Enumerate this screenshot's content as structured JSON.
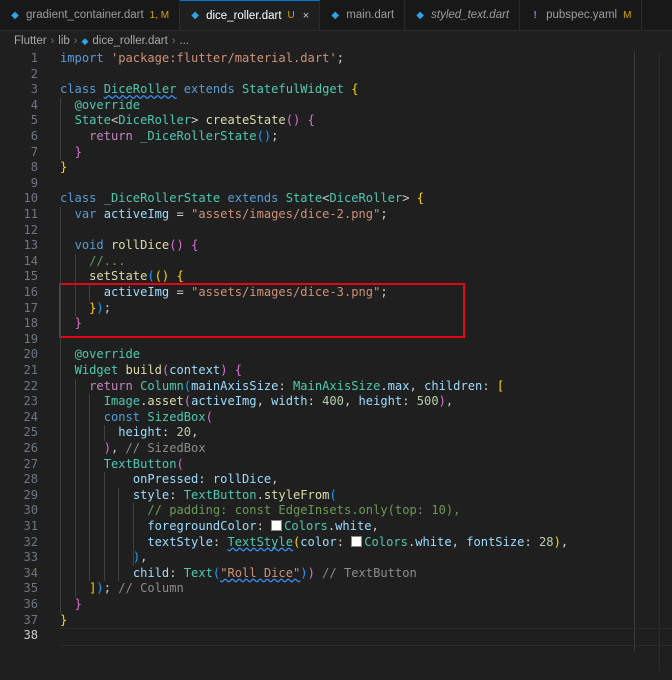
{
  "tabs": [
    {
      "label": "gradient_container.dart",
      "badge": "1, M",
      "icon": "dart-icon",
      "active": false
    },
    {
      "label": "dice_roller.dart",
      "badge": "U",
      "icon": "dart-icon",
      "active": true,
      "close": "×"
    },
    {
      "label": "main.dart",
      "icon": "dart-icon",
      "active": false
    },
    {
      "label": "styled_text.dart",
      "icon": "dart-icon",
      "active": false,
      "italic": true
    },
    {
      "label": "pubspec.yaml",
      "badge": "M",
      "icon": "warning-exclamation-icon",
      "active": false
    }
  ],
  "breadcrumb": {
    "items": [
      "Flutter",
      "lib",
      "dice_roller.dart",
      "..."
    ],
    "separator": "›"
  },
  "editor": {
    "line_numbers": [
      "1",
      "2",
      "3",
      "4",
      "5",
      "6",
      "7",
      "8",
      "9",
      "10",
      "11",
      "12",
      "13",
      "14",
      "15",
      "16",
      "17",
      "18",
      "19",
      "20",
      "21",
      "22",
      "23",
      "24",
      "25",
      "26",
      "27",
      "28",
      "29",
      "30",
      "31",
      "32",
      "33",
      "34",
      "35",
      "36",
      "37",
      "38"
    ],
    "current_line": "38",
    "lines": [
      [
        [
          "import",
          "kw"
        ],
        [
          " ",
          "txt"
        ],
        [
          "'package:flutter/material.dart'",
          "str"
        ],
        [
          ";",
          "txt"
        ]
      ],
      [],
      [
        [
          "class",
          "kw"
        ],
        [
          " ",
          "txt"
        ],
        [
          "DiceRoller",
          "cls sq"
        ],
        [
          " ",
          "txt"
        ],
        [
          "extends",
          "kw"
        ],
        [
          " ",
          "txt"
        ],
        [
          "StatefulWidget",
          "cls"
        ],
        [
          " ",
          "txt"
        ],
        [
          "{",
          "p1"
        ]
      ],
      [
        [
          "  ",
          "txt"
        ],
        [
          "@override",
          "ann"
        ]
      ],
      [
        [
          "  ",
          "txt"
        ],
        [
          "State",
          "cls"
        ],
        [
          "<",
          "txt"
        ],
        [
          "DiceRoller",
          "cls"
        ],
        [
          ">",
          "txt"
        ],
        [
          " ",
          "txt"
        ],
        [
          "createState",
          "fn"
        ],
        [
          "()",
          "p2"
        ],
        [
          " ",
          "txt"
        ],
        [
          "{",
          "p2"
        ]
      ],
      [
        [
          "    ",
          "txt"
        ],
        [
          "return",
          "ctl"
        ],
        [
          " ",
          "txt"
        ],
        [
          "_DiceRollerState",
          "cls"
        ],
        [
          "()",
          "p3"
        ],
        [
          ";",
          "txt"
        ]
      ],
      [
        [
          "  ",
          "txt"
        ],
        [
          "}",
          "p2"
        ]
      ],
      [
        [
          "}",
          "p1"
        ]
      ],
      [],
      [
        [
          "class",
          "kw"
        ],
        [
          " ",
          "txt"
        ],
        [
          "_DiceRollerState",
          "cls"
        ],
        [
          " ",
          "txt"
        ],
        [
          "extends",
          "kw"
        ],
        [
          " ",
          "txt"
        ],
        [
          "State",
          "cls"
        ],
        [
          "<",
          "txt"
        ],
        [
          "DiceRoller",
          "cls"
        ],
        [
          ">",
          "txt"
        ],
        [
          " ",
          "txt"
        ],
        [
          "{",
          "p1"
        ]
      ],
      [
        [
          "  ",
          "txt"
        ],
        [
          "var",
          "kw"
        ],
        [
          " ",
          "txt"
        ],
        [
          "activeImg",
          "var"
        ],
        [
          " = ",
          "txt"
        ],
        [
          "\"assets/images/dice-2.png\"",
          "str"
        ],
        [
          ";",
          "txt"
        ]
      ],
      [],
      [
        [
          "  ",
          "txt"
        ],
        [
          "void",
          "kw"
        ],
        [
          " ",
          "txt"
        ],
        [
          "rollDice",
          "fn"
        ],
        [
          "()",
          "p2"
        ],
        [
          " ",
          "txt"
        ],
        [
          "{",
          "p2"
        ]
      ],
      [
        [
          "    ",
          "txt"
        ],
        [
          "//...",
          "cm"
        ]
      ],
      [
        [
          "    ",
          "txt"
        ],
        [
          "setState",
          "fn"
        ],
        [
          "(",
          "p3"
        ],
        [
          "()",
          "p1"
        ],
        [
          " ",
          "txt"
        ],
        [
          "{",
          "p1"
        ]
      ],
      [
        [
          "      ",
          "txt"
        ],
        [
          "activeImg",
          "var"
        ],
        [
          " = ",
          "txt"
        ],
        [
          "\"assets/images/dice-3.png\"",
          "str"
        ],
        [
          ";",
          "txt"
        ]
      ],
      [
        [
          "    ",
          "txt"
        ],
        [
          "}",
          "p1"
        ],
        [
          ")",
          "p3"
        ],
        [
          ";",
          "txt"
        ]
      ],
      [
        [
          "  ",
          "txt"
        ],
        [
          "}",
          "p2"
        ]
      ],
      [],
      [
        [
          "  ",
          "txt"
        ],
        [
          "@override",
          "ann"
        ]
      ],
      [
        [
          "  ",
          "txt"
        ],
        [
          "Widget",
          "cls"
        ],
        [
          " ",
          "txt"
        ],
        [
          "build",
          "fn"
        ],
        [
          "(",
          "p2"
        ],
        [
          "context",
          "var"
        ],
        [
          ")",
          "p2"
        ],
        [
          " ",
          "txt"
        ],
        [
          "{",
          "p2"
        ]
      ],
      [
        [
          "    ",
          "txt"
        ],
        [
          "return",
          "ctl"
        ],
        [
          " ",
          "txt"
        ],
        [
          "Column",
          "cls"
        ],
        [
          "(",
          "p3"
        ],
        [
          "mainAxisSize",
          "var"
        ],
        [
          ": ",
          "txt"
        ],
        [
          "MainAxisSize",
          "cls"
        ],
        [
          ".",
          "txt"
        ],
        [
          "max",
          "var"
        ],
        [
          ", ",
          "txt"
        ],
        [
          "children",
          "var"
        ],
        [
          ": ",
          "txt"
        ],
        [
          "[",
          "p1"
        ]
      ],
      [
        [
          "      ",
          "txt"
        ],
        [
          "Image",
          "cls"
        ],
        [
          ".",
          "txt"
        ],
        [
          "asset",
          "fn"
        ],
        [
          "(",
          "p2"
        ],
        [
          "activeImg",
          "var"
        ],
        [
          ", ",
          "txt"
        ],
        [
          "width",
          "var"
        ],
        [
          ": ",
          "txt"
        ],
        [
          "400",
          "num"
        ],
        [
          ", ",
          "txt"
        ],
        [
          "height",
          "var"
        ],
        [
          ": ",
          "txt"
        ],
        [
          "500",
          "num"
        ],
        [
          ")",
          "p2"
        ],
        [
          ",",
          "txt"
        ]
      ],
      [
        [
          "      ",
          "txt"
        ],
        [
          "const",
          "kw"
        ],
        [
          " ",
          "txt"
        ],
        [
          "SizedBox",
          "cls"
        ],
        [
          "(",
          "p2"
        ]
      ],
      [
        [
          "        ",
          "txt"
        ],
        [
          "height",
          "var"
        ],
        [
          ": ",
          "txt"
        ],
        [
          "20",
          "num"
        ],
        [
          ",",
          "txt"
        ]
      ],
      [
        [
          "      ",
          "txt"
        ],
        [
          ")",
          "p2"
        ],
        [
          ", ",
          "txt"
        ],
        [
          "// SizedBox",
          "gray"
        ]
      ],
      [
        [
          "      ",
          "txt"
        ],
        [
          "TextButton",
          "cls"
        ],
        [
          "(",
          "p2"
        ]
      ],
      [
        [
          "          ",
          "txt"
        ],
        [
          "onPressed",
          "var"
        ],
        [
          ": ",
          "txt"
        ],
        [
          "rollDice",
          "var"
        ],
        [
          ",",
          "txt"
        ]
      ],
      [
        [
          "          ",
          "txt"
        ],
        [
          "style",
          "var"
        ],
        [
          ": ",
          "txt"
        ],
        [
          "TextButton",
          "cls"
        ],
        [
          ".",
          "txt"
        ],
        [
          "styleFrom",
          "fn"
        ],
        [
          "(",
          "p3"
        ]
      ],
      [
        [
          "            ",
          "txt"
        ],
        [
          "// padding: const EdgeInsets.only(top: 10),",
          "cm"
        ]
      ],
      [
        [
          "            ",
          "txt"
        ],
        [
          "foregroundColor",
          "var"
        ],
        [
          ": ",
          "txt"
        ],
        [
          "■",
          "swatch"
        ],
        [
          "Colors",
          "cls"
        ],
        [
          ".",
          "txt"
        ],
        [
          "white",
          "var"
        ],
        [
          ",",
          "txt"
        ]
      ],
      [
        [
          "            ",
          "txt"
        ],
        [
          "textStyle",
          "var"
        ],
        [
          ": ",
          "txt"
        ],
        [
          "TextStyle",
          "cls sq"
        ],
        [
          "(",
          "p1"
        ],
        [
          "color",
          "var"
        ],
        [
          ": ",
          "txt"
        ],
        [
          "■",
          "swatch"
        ],
        [
          "Colors",
          "cls"
        ],
        [
          ".",
          "txt"
        ],
        [
          "white",
          "var"
        ],
        [
          ", ",
          "txt"
        ],
        [
          "fontSize",
          "var"
        ],
        [
          ": ",
          "txt"
        ],
        [
          "28",
          "num"
        ],
        [
          ")",
          "p1"
        ],
        [
          ",",
          "txt"
        ]
      ],
      [
        [
          "          ",
          "txt"
        ],
        [
          ")",
          "p3"
        ],
        [
          ",",
          "txt"
        ]
      ],
      [
        [
          "          ",
          "txt"
        ],
        [
          "child",
          "var"
        ],
        [
          ": ",
          "txt"
        ],
        [
          "Text",
          "cls"
        ],
        [
          "(",
          "p3"
        ],
        [
          "\"Roll Dice\"",
          "str sq"
        ],
        [
          ")",
          "p3"
        ],
        [
          ")",
          "p2"
        ],
        [
          " ",
          "txt"
        ],
        [
          "// TextButton",
          "gray"
        ]
      ],
      [
        [
          "    ",
          "txt"
        ],
        [
          "]",
          "p1"
        ],
        [
          ")",
          "p3"
        ],
        [
          ";",
          "txt"
        ],
        [
          " ",
          "txt"
        ],
        [
          "// Column",
          "gray"
        ]
      ],
      [
        [
          "  ",
          "txt"
        ],
        [
          "}",
          "p2"
        ]
      ],
      [
        [
          "}",
          "p1"
        ]
      ],
      []
    ]
  },
  "colors": {
    "highlight_box": "#e30613",
    "background": "#1f1f1f",
    "tab_bar": "#181818"
  }
}
